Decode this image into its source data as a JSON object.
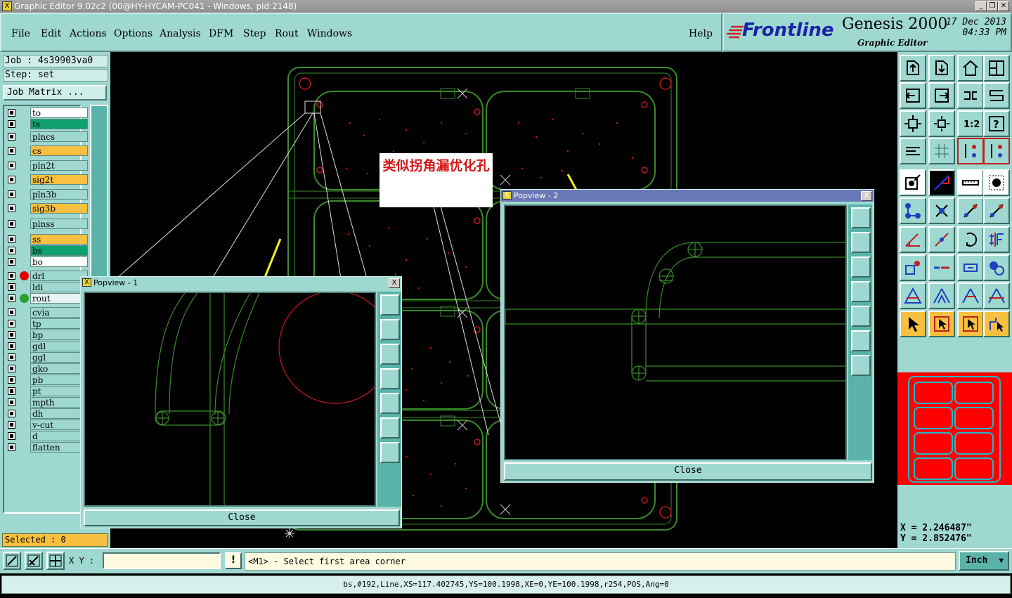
{
  "window": {
    "title": "Graphic Editor 9.02c2 (00@HY-HYCAM-PC041 - Windows, pid:2148)",
    "app_icon": "X"
  },
  "menu": {
    "items": [
      "File",
      "Edit",
      "Actions",
      "Options",
      "Analysis",
      "DFM",
      "Step",
      "Rout",
      "Windows"
    ],
    "help": "Help"
  },
  "logo": {
    "brand": "Frontline",
    "product": "Genesis 2000",
    "subtitle": "Graphic Editor",
    "date": "17 Dec 2013",
    "time": "04:33 PM"
  },
  "job": {
    "job_line": "Job : 4s39903va0",
    "step_line": "Step: set",
    "matrix_button": "Job Matrix ..."
  },
  "layers": [
    {
      "name": "to",
      "color": "#ffffff"
    },
    {
      "name": "ts",
      "color": "#0fa070"
    },
    {
      "name": "plncs",
      "color": "#9fd8d0"
    },
    {
      "name": "cs",
      "color": "#f8c040"
    },
    {
      "name": "pln2t",
      "color": "#9fd8d0"
    },
    {
      "name": "sig2t",
      "color": "#f8c040"
    },
    {
      "name": "pln3b",
      "color": "#9fd8d0"
    },
    {
      "name": "sig3b",
      "color": "#f8c040"
    },
    {
      "name": "plnss",
      "color": "#9fd8d0"
    },
    {
      "name": "ss",
      "color": "#f8c040"
    },
    {
      "name": "bs",
      "color": "#0fa070"
    },
    {
      "name": "bo",
      "color": "#ffffff"
    },
    {
      "name": "drl",
      "color": "#9fd8d0",
      "dot": "#e00000"
    },
    {
      "name": "ldi",
      "color": "#9fd8d0"
    },
    {
      "name": "rout",
      "color": "#e8f4f2",
      "dot": "#2aa02a"
    },
    {
      "name": "cvia",
      "color": "#9fd8d0"
    },
    {
      "name": "tp",
      "color": "#9fd8d0"
    },
    {
      "name": "bp",
      "color": "#9fd8d0"
    },
    {
      "name": "gdl",
      "color": "#9fd8d0"
    },
    {
      "name": "ggl",
      "color": "#9fd8d0"
    },
    {
      "name": "gko",
      "color": "#9fd8d0"
    },
    {
      "name": "pb",
      "color": "#9fd8d0"
    },
    {
      "name": "pt",
      "color": "#9fd8d0"
    },
    {
      "name": "mpth",
      "color": "#9fd8d0"
    },
    {
      "name": "dh",
      "color": "#9fd8d0"
    },
    {
      "name": "v-cut",
      "color": "#9fd8d0"
    },
    {
      "name": "d",
      "color": "#9fd8d0"
    },
    {
      "name": "flatten",
      "color": "#9fd8d0"
    }
  ],
  "selected_text": "Selected : 0",
  "annotation_text": "类似拐角漏优化孔",
  "popview1": {
    "title": "Popview - 1",
    "close": "Close",
    "close_glyph": "X"
  },
  "popview2": {
    "title": "Popview - 2",
    "close": "Close",
    "close_glyph": "X"
  },
  "coords": {
    "x": "X = 2.246487\"",
    "y": "Y = 2.852476\""
  },
  "bottom": {
    "xy_label": "X Y :",
    "xy_value": "",
    "bang": "!",
    "prompt": "<M1> - Select first area corner",
    "units": "Inch"
  },
  "status": "bs,#192,Line,XS=117.402745,YS=100.1998,XE=0,YE=100.1998,r254,POS,Ang=0",
  "colors": {
    "panel": "#9fd8d0",
    "board": "#3a8a2a",
    "holes": "#e01818",
    "highlight": "#f8c040",
    "selection_arrow": "#f0f020"
  }
}
